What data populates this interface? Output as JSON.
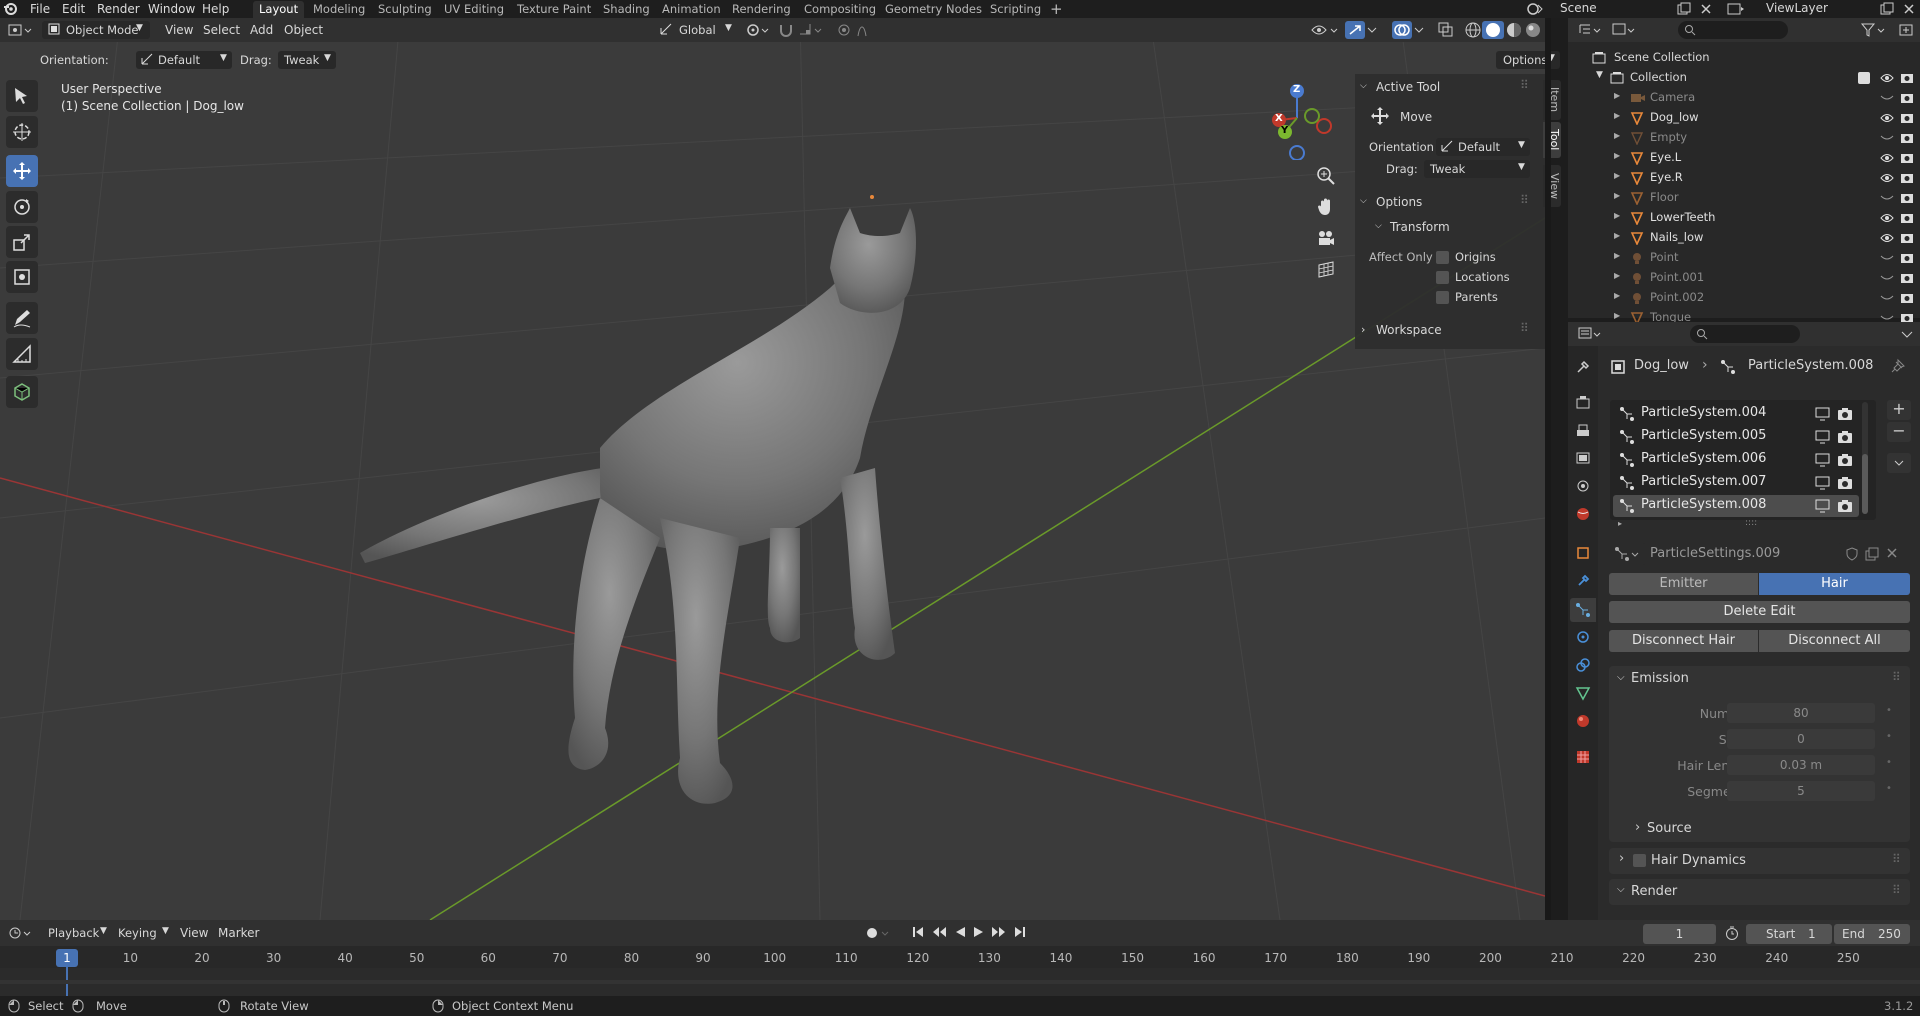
{
  "topbar": {
    "menus": [
      "File",
      "Edit",
      "Render",
      "Window",
      "Help"
    ],
    "workspaces": [
      "Layout",
      "Modeling",
      "Sculpting",
      "UV Editing",
      "Texture Paint",
      "Shading",
      "Animation",
      "Rendering",
      "Compositing",
      "Geometry Nodes",
      "Scripting"
    ],
    "active_workspace": "Layout",
    "scene": "Scene",
    "view_layer": "ViewLayer"
  },
  "viewport_header": {
    "mode": "Object Mode",
    "menus": [
      "View",
      "Select",
      "Add",
      "Object"
    ],
    "transform_orientation": "Global",
    "orientation_label": "Orientation:",
    "orientation_value": "Default",
    "drag_label": "Drag:",
    "drag_value": "Tweak",
    "options": "Options"
  },
  "viewport": {
    "perspective": "User Perspective",
    "collection_path": "(1) Scene Collection | Dog_low",
    "axes": {
      "x": "X",
      "y": "Y",
      "z": "Z"
    }
  },
  "npanel": {
    "tabs": [
      "Item",
      "Tool",
      "View"
    ],
    "active_tool_title": "Active Tool",
    "active_tool_name": "Move",
    "orientation_label": "Orientation",
    "orientation_value": "Default",
    "drag_label": "Drag:",
    "drag_value": "Tweak",
    "options_title": "Options",
    "transform_title": "Transform",
    "affect_only_label": "Affect Only",
    "checkboxes": [
      "Origins",
      "Locations",
      "Parents"
    ],
    "workspace_title": "Workspace"
  },
  "outliner": {
    "root": "Scene Collection",
    "collection": "Collection",
    "items": [
      {
        "name": "Camera",
        "dim": true
      },
      {
        "name": "Dog_low",
        "dim": false
      },
      {
        "name": "Empty",
        "dim": true
      },
      {
        "name": "Eye.L",
        "dim": false
      },
      {
        "name": "Eye.R",
        "dim": false
      },
      {
        "name": "Floor",
        "dim": true
      },
      {
        "name": "LowerTeeth",
        "dim": false
      },
      {
        "name": "Nails_low",
        "dim": false
      },
      {
        "name": "Point",
        "dim": true
      },
      {
        "name": "Point.001",
        "dim": true
      },
      {
        "name": "Point.002",
        "dim": true
      },
      {
        "name": "Tongue",
        "dim": true
      }
    ]
  },
  "properties": {
    "breadcrumb_object": "Dog_low",
    "breadcrumb_system": "ParticleSystem.008",
    "particle_systems": [
      "ParticleSystem.004",
      "ParticleSystem.005",
      "ParticleSystem.006",
      "ParticleSystem.007",
      "ParticleSystem.008"
    ],
    "selected_system": "ParticleSystem.008",
    "settings_name": "ParticleSettings.009",
    "type_emitter": "Emitter",
    "type_hair": "Hair",
    "delete_edit": "Delete Edit",
    "disconnect_hair": "Disconnect Hair",
    "disconnect_all": "Disconnect All",
    "emission_title": "Emission",
    "fields": [
      {
        "label": "Number",
        "value": "80"
      },
      {
        "label": "Seed",
        "value": "0"
      },
      {
        "label": "Hair Length",
        "value": "0.03 m"
      },
      {
        "label": "Segments",
        "value": "5"
      }
    ],
    "source_title": "Source",
    "hair_dynamics_title": "Hair Dynamics",
    "render_title": "Render"
  },
  "timeline": {
    "menus": [
      "Playback",
      "Keying",
      "View",
      "Marker"
    ],
    "current_frame": "1",
    "start_label": "Start",
    "start_value": "1",
    "end_label": "End",
    "end_value": "250",
    "ruler_marks": [
      "1",
      "10",
      "20",
      "30",
      "40",
      "50",
      "60",
      "70",
      "80",
      "90",
      "100",
      "110",
      "120",
      "130",
      "140",
      "150",
      "160",
      "170",
      "180",
      "190",
      "200",
      "210",
      "220",
      "230",
      "240",
      "250"
    ]
  },
  "statusbar": {
    "select": "Select",
    "move": "Move",
    "rotate_view": "Rotate View",
    "context_menu": "Object Context Menu",
    "version": "3.1.2"
  },
  "colors": {
    "accent": "#4772b3",
    "viewport_bg": "#3b3b3b",
    "x_axis": "#c0392b",
    "y_axis": "#6a9a2a",
    "object_orange": "#e8883a",
    "mesh_green": "#63c48f"
  }
}
